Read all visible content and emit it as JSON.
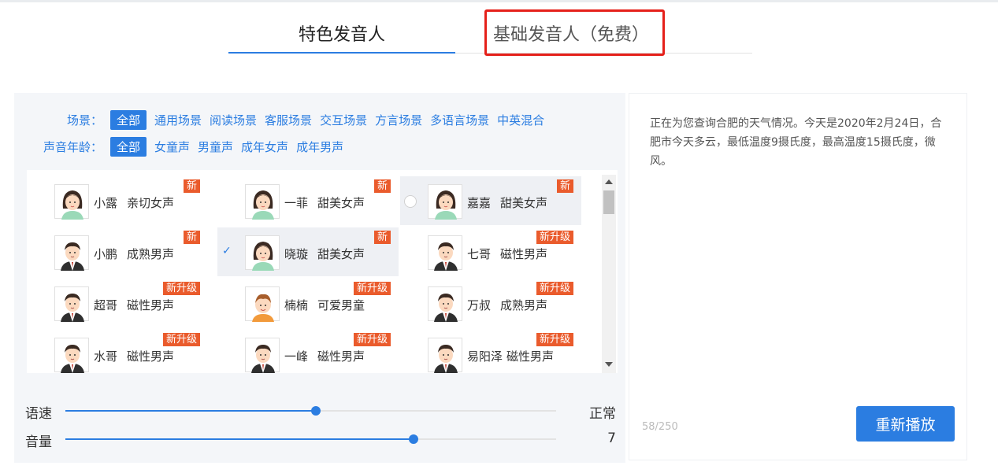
{
  "tabs": {
    "special": "特色发音人",
    "basic": "基础发音人（免费）"
  },
  "filters": {
    "scene": {
      "label": "场景：",
      "options": [
        "全部",
        "通用场景",
        "阅读场景",
        "客服场景",
        "交互场景",
        "方言场景",
        "多语言场景",
        "中英混合"
      ],
      "active": "全部"
    },
    "age": {
      "label": "声音年龄：",
      "options": [
        "全部",
        "女童声",
        "男童声",
        "成年女声",
        "成年男声"
      ],
      "active": "全部"
    }
  },
  "voices": [
    {
      "name": "小露",
      "desc": "亲切女声",
      "badge": "新",
      "avatar": "female-avatar-icon",
      "state": "normal"
    },
    {
      "name": "一菲",
      "desc": "甜美女声",
      "badge": "新",
      "avatar": "female-avatar-icon",
      "state": "normal"
    },
    {
      "name": "嘉嘉",
      "desc": "甜美女声",
      "badge": "新",
      "avatar": "female-avatar-icon",
      "state": "hover"
    },
    {
      "name": "小鹏",
      "desc": "成熟男声",
      "badge": "新",
      "avatar": "male-avatar-icon",
      "state": "normal"
    },
    {
      "name": "晓璇",
      "desc": "甜美女声",
      "badge": "新",
      "avatar": "female-avatar-icon",
      "state": "selected"
    },
    {
      "name": "七哥",
      "desc": "磁性男声",
      "badge": "新升级",
      "avatar": "male-avatar-icon",
      "state": "normal"
    },
    {
      "name": "超哥",
      "desc": "磁性男声",
      "badge": "新升级",
      "avatar": "male-avatar-icon",
      "state": "normal"
    },
    {
      "name": "楠楠",
      "desc": "可爱男童",
      "badge": "新升级",
      "avatar": "boy-avatar-icon",
      "state": "normal"
    },
    {
      "name": "万叔",
      "desc": "成熟男声",
      "badge": "新升级",
      "avatar": "male-avatar-icon",
      "state": "normal"
    },
    {
      "name": "水哥",
      "desc": "磁性男声",
      "badge": "新升级",
      "avatar": "male-avatar-icon",
      "state": "normal"
    },
    {
      "name": "一峰",
      "desc": "磁性男声",
      "badge": "新升级",
      "avatar": "male-avatar-icon",
      "state": "normal"
    },
    {
      "name": "易阳泽",
      "desc": "磁性男声",
      "badge": "新升级",
      "avatar": "male-avatar-icon",
      "state": "normal"
    }
  ],
  "sliders": {
    "speed": {
      "label": "语速",
      "value_text": "正常",
      "fraction": 0.51
    },
    "volume": {
      "label": "音量",
      "value_text": "7",
      "fraction": 0.71
    }
  },
  "preview": {
    "text": "正在为您查询合肥的天气情况。今天是2020年2月24日，合肥市今天多云，最低温度9摄氏度，最高温度15摄氏度，微风。",
    "char_count": "58/250",
    "replay_label": "重新播放"
  },
  "colors": {
    "accent": "#2b7de1",
    "badge": "#ea5b2c",
    "highlight": "#e5201a"
  }
}
